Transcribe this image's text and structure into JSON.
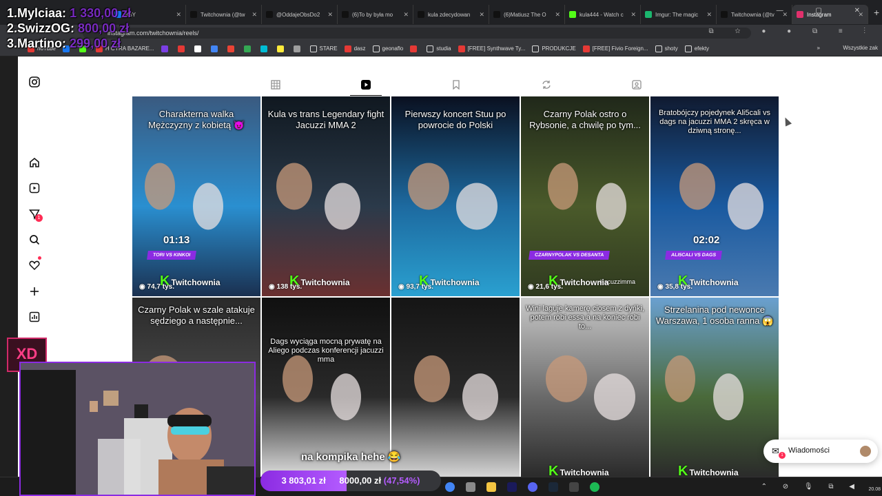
{
  "browser": {
    "tabs": [
      {
        "title": "ASY",
        "color": "#1877f2"
      },
      {
        "title": "Twitchownia (@tw",
        "color": "#111111"
      },
      {
        "title": "@OddajeObsDo2",
        "color": "#111111"
      },
      {
        "title": "(6)To by była mo",
        "color": "#111111"
      },
      {
        "title": "kula zdecydowan",
        "color": "#111111"
      },
      {
        "title": "(6)Matiusz The O",
        "color": "#111111"
      },
      {
        "title": "kula444 - Watch c",
        "color": "#53fc18"
      },
      {
        "title": "Imgur: The magic",
        "color": "#1bb76e"
      },
      {
        "title": "Twitchownia (@tv",
        "color": "#111111"
      },
      {
        "title": "Instagram",
        "color": "#e1306c"
      }
    ],
    "active_tab": "Instagram",
    "new_tab_symbol": "+",
    "url": "instagram.com/twitchownia/reels/",
    "bookmarks": [
      {
        "label": "noTube",
        "color": "#e53935"
      },
      {
        "label": "",
        "color": "#1877f2"
      },
      {
        "label": "",
        "color": "#53fc18"
      },
      {
        "label": "H CYRA BAZARE...",
        "color": "#e53935"
      },
      {
        "label": "",
        "color": "#7b3fe4"
      },
      {
        "label": "",
        "color": "#e53935"
      },
      {
        "label": "",
        "color": "#ffffff"
      },
      {
        "label": "",
        "color": "#4285f4"
      },
      {
        "label": "",
        "color": "#ea4335"
      },
      {
        "label": "",
        "color": "#34a853"
      },
      {
        "label": "",
        "color": "#00bcd4"
      },
      {
        "label": "",
        "color": "#ffeb3b"
      },
      {
        "label": "",
        "color": "#9e9e9e"
      },
      {
        "label": "STARE",
        "color": "#dcdcdc"
      },
      {
        "label": "dasz",
        "color": "#e53935"
      },
      {
        "label": "geonaflo",
        "color": "#dcdcdc"
      },
      {
        "label": "",
        "color": "#e53935"
      },
      {
        "label": "studia",
        "color": "#dcdcdc"
      },
      {
        "label": "[FREE] Synthwave Ty...",
        "color": "#e53935"
      },
      {
        "label": "PRODUKCJE",
        "color": "#dcdcdc"
      },
      {
        "label": "[FREE] Fivio Foreign...",
        "color": "#e53935"
      },
      {
        "label": "shoty",
        "color": "#dcdcdc"
      },
      {
        "label": "efekty",
        "color": "#dcdcdc"
      }
    ],
    "bookmarks_more": "»",
    "bookmarks_right": "Wszystkie zak"
  },
  "sidebar": {
    "icons": [
      "instagram-logo",
      "home",
      "reels",
      "messages",
      "search",
      "notifications",
      "create",
      "stats"
    ],
    "messages_badge": "1"
  },
  "profile_tabs": [
    "posts",
    "reels",
    "saved",
    "reposts",
    "tagged"
  ],
  "active_profile_tab": "reels",
  "reels": [
    {
      "caption": "Charakterna walka Mężczyzny z kobietą 😈",
      "views": "74,7 tys.",
      "time": "01:13",
      "tag": "TORI VS KINKOI",
      "bg": [
        "#3a5a80",
        "#2a8fd0",
        "#1a3050"
      ]
    },
    {
      "caption": "Kula vs trans Legendary fight Jacuzzi MMA 2",
      "views": "138 tys.",
      "time": "",
      "tag": "",
      "bg": [
        "#101820",
        "#2b3a4a",
        "#6a3030"
      ]
    },
    {
      "caption": "Pierwszy koncert Stuu po powrocie do Polski",
      "views": "93,7 tys.",
      "time": "",
      "tag": "",
      "bg": [
        "#0a1020",
        "#1d6aa0",
        "#2aa0d0"
      ]
    },
    {
      "caption": "Czarny Polak ostro o Rybsonie, a chwilę po tym...",
      "views": "21,6 tys.",
      "time": "",
      "tag": "CZARNYPOLAK VS DESANTA",
      "sub": "#jacuzzimma",
      "bg": [
        "#20281a",
        "#4a5a2a",
        "#303a20"
      ]
    },
    {
      "caption": "Bratobójczy pojedynek Ali5cali vs dags na jacuzzi MMA 2 skręca w dziwną stronę...",
      "views": "35,8 tys.",
      "time": "02:02",
      "tag": "ALI5CALI VS DAGS",
      "bg": [
        "#101a30",
        "#1a5aa0",
        "#4a7ab0"
      ]
    },
    {
      "caption": "Czarny Polak w szale atakuje sędziego a następnie...",
      "views": "",
      "time": "",
      "tag": "",
      "bg": [
        "#2a2a2a",
        "#4a4a4a",
        "#303030"
      ]
    },
    {
      "caption": "Dags wyciąga mocną prywatę na Aliego podczas konferencji jacuzzi mma",
      "views": "",
      "time": "",
      "tag": "",
      "bg": [
        "#101010",
        "#2a2a2a",
        "#e0e0e0"
      ]
    },
    {
      "caption": "",
      "views": "",
      "time": "",
      "tag": "",
      "bg": [
        "#151515",
        "#2a2a2a",
        "#d8d8d8"
      ]
    },
    {
      "caption": "Wini laguje kamerę ciosem z dyńki, potem robi essa a na koniec robi to...",
      "views": "",
      "time": "",
      "tag": "",
      "bg": [
        "#c8c8c8",
        "#6a6a6a",
        "#2a2a2a"
      ]
    },
    {
      "caption": "Strzelanina pod newonce Warszawa, 1 osoba ranna 😱",
      "views": "",
      "time": "",
      "tag": "",
      "bg": [
        "#6aa0d0",
        "#4a6a3a",
        "#2a2a2a"
      ]
    }
  ],
  "watermark": "Twitchownia",
  "messages_panel": {
    "label": "Wiadomości",
    "badge": "1"
  },
  "taskbar": {
    "apps": [
      {
        "name": "chrome-icon",
        "color": "#4285f4"
      },
      {
        "name": "app-icon",
        "color": "#8a8a8a"
      },
      {
        "name": "folder-icon",
        "color": "#f4c542"
      },
      {
        "name": "premiere-icon",
        "color": "#1a1a5a"
      },
      {
        "name": "discord-icon",
        "color": "#5865f2"
      },
      {
        "name": "steam-icon",
        "color": "#1b2838"
      },
      {
        "name": "app2-icon",
        "color": "#444444"
      },
      {
        "name": "spotify-icon",
        "color": "#1db954"
      }
    ],
    "clock_line2": "20.08"
  },
  "stream_overlay": {
    "donors": [
      {
        "rank": "1.",
        "name": "Mylciaa:",
        "amount": "1 330,00 zł"
      },
      {
        "rank": "2.",
        "name": "SwizzOG:",
        "amount": "800,00 zł"
      },
      {
        "rank": "3.",
        "name": "Martino:",
        "amount": "299,00 zł"
      }
    ],
    "emote": "XD",
    "goal": {
      "current": "3 803,01 zł",
      "target": "8000,00 zł",
      "percent": "(47,54%)",
      "fraction": 0.4754
    },
    "caption": "na kompika hehe 😂"
  }
}
